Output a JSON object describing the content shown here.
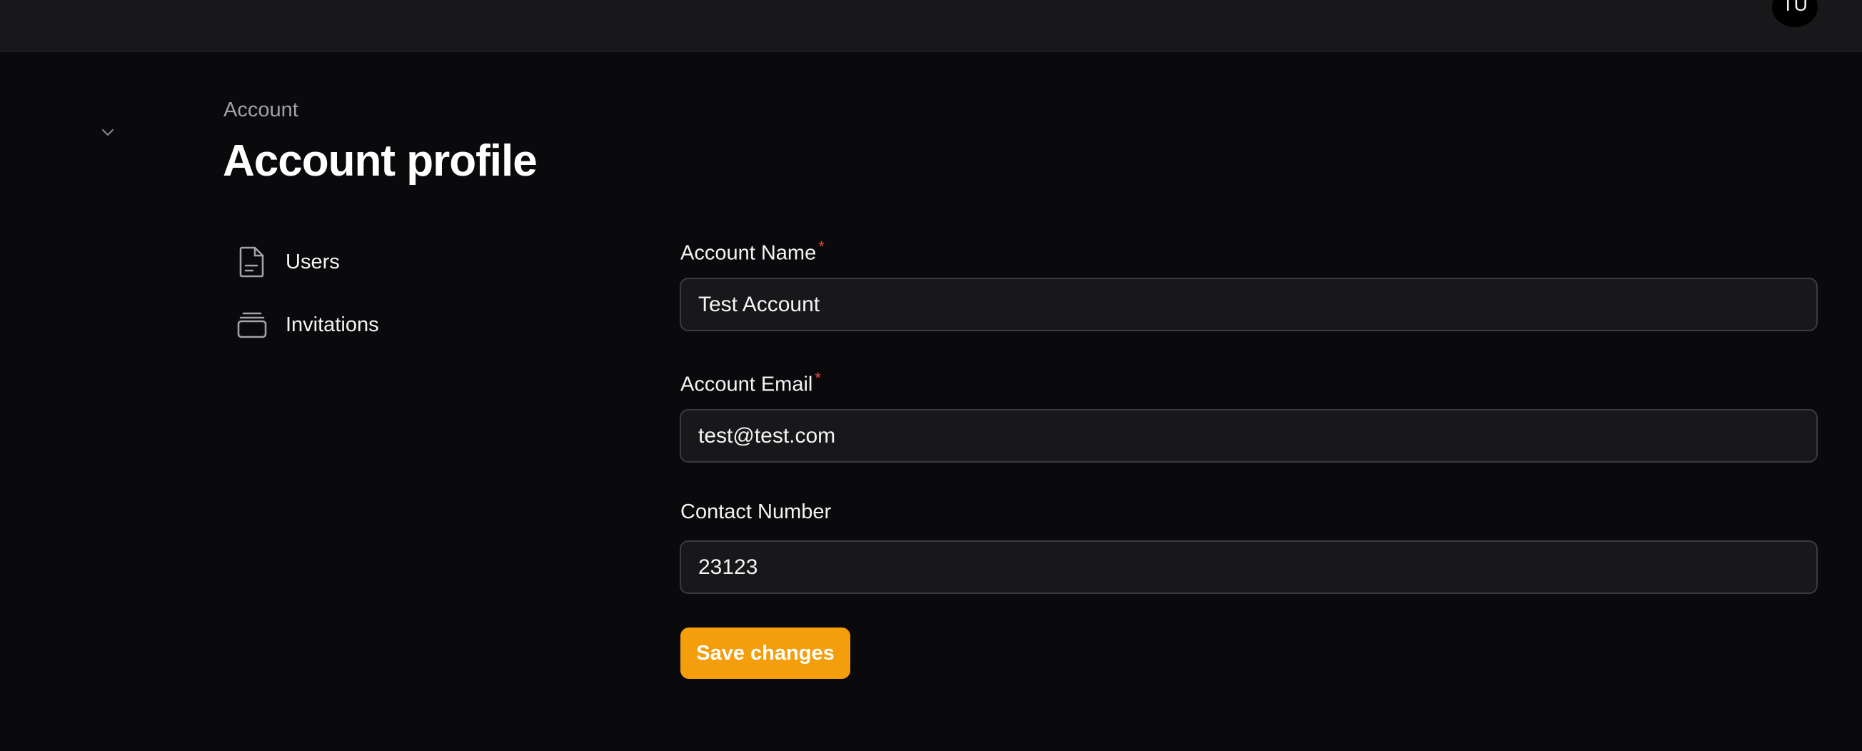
{
  "header": {
    "user_initials": "TU"
  },
  "breadcrumb": "Account",
  "page_title": "Account profile",
  "subnav": [
    {
      "label": "Users",
      "icon": "document-icon"
    },
    {
      "label": "Invitations",
      "icon": "stack-icon"
    }
  ],
  "form": {
    "account_name": {
      "label": "Account Name",
      "required_mark": "*",
      "value": "Test Account"
    },
    "account_email": {
      "label": "Account Email",
      "required_mark": "*",
      "value": "test@test.com"
    },
    "contact_number": {
      "label": "Contact Number",
      "value": "23123"
    },
    "save_label": "Save changes"
  },
  "colors": {
    "background": "#0a0a0c",
    "topbar": "#18181b",
    "accent": "#f59e0b",
    "required": "#ef4444"
  }
}
